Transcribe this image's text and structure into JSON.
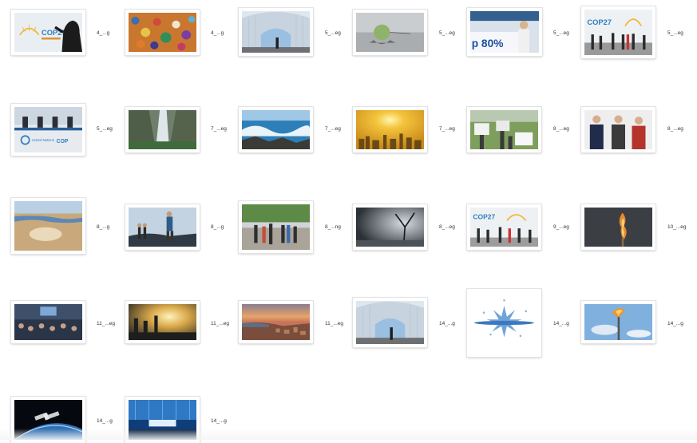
{
  "files": [
    {
      "label": "4_...g",
      "desc": "cop27-logo-silhouette-icon"
    },
    {
      "label": "4_...g",
      "desc": "crowd-colorful-icon"
    },
    {
      "label": "5_...eg",
      "desc": "pavilion-entrance-icon"
    },
    {
      "label": "5_...eg",
      "desc": "globe-on-rock-icon"
    },
    {
      "label": "5_...eg",
      "desc": "banner-protester-icon"
    },
    {
      "label": "5_...eg",
      "desc": "cop27-venue-crowd-icon"
    },
    {
      "label": "5_...eg",
      "desc": "panel-stage-icon"
    },
    {
      "label": "7_...eg",
      "desc": "waterfall-cliff-icon"
    },
    {
      "label": "7_...eg",
      "desc": "sea-waves-rocks-icon"
    },
    {
      "label": "7_...eg",
      "desc": "hazy-sun-city-icon"
    },
    {
      "label": "8_...eg",
      "desc": "protest-banners-icon"
    },
    {
      "label": "8_...eg",
      "desc": "three-leaders-icon"
    },
    {
      "label": "8_...g",
      "desc": "dry-riverbed-icon"
    },
    {
      "label": "8_...g",
      "desc": "runners-icon"
    },
    {
      "label": "8_...ng",
      "desc": "street-crowd-icon"
    },
    {
      "label": "8_...eg",
      "desc": "storm-tree-icon"
    },
    {
      "label": "9_...eg",
      "desc": "cop27-crowd-icon"
    },
    {
      "label": "10_...eg",
      "desc": "burning-match-icon"
    },
    {
      "label": "11_...eg",
      "desc": "conference-audience-icon"
    },
    {
      "label": "11_...eg",
      "desc": "smokestacks-icon"
    },
    {
      "label": "11_...eg",
      "desc": "coastal-city-sunset-icon"
    },
    {
      "label": "14_...g",
      "desc": "pavilion-entrance-icon"
    },
    {
      "label": "14_...g",
      "desc": "water-splash-icon"
    },
    {
      "label": "14_...g",
      "desc": "gas-flare-icon"
    },
    {
      "label": "14_...g",
      "desc": "satellite-earth-icon"
    },
    {
      "label": "14_...g",
      "desc": "blue-stage-icon"
    }
  ],
  "logo_text": "COP27"
}
